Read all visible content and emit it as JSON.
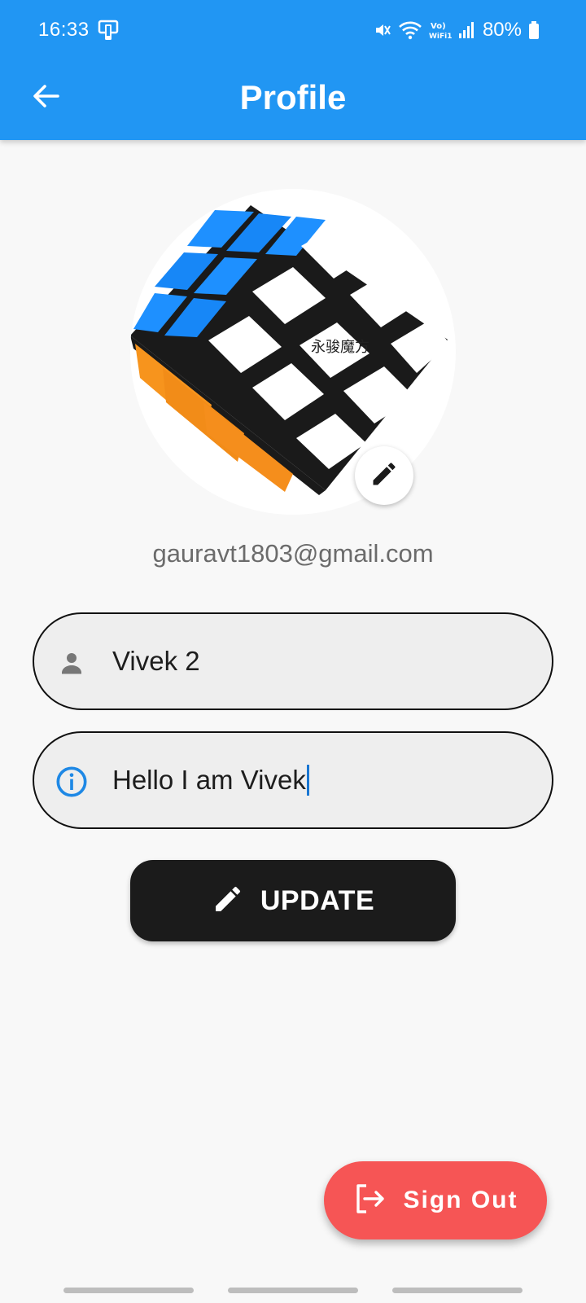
{
  "status_bar": {
    "time": "16:33",
    "battery": "80%",
    "network_label": "Vo) WiFi1",
    "icons": [
      "screen-cast-icon",
      "mute-icon",
      "wifi-icon",
      "vowifi-icon",
      "signal-icon",
      "battery-icon"
    ]
  },
  "app_bar": {
    "title": "Profile",
    "back_icon": "arrow-left-icon",
    "background": "#2196f3"
  },
  "profile": {
    "avatar_description": "rubiks-cube-image",
    "avatar_logo_text": "永骏魔方",
    "edit_icon": "pencil-icon",
    "email": "gauravt1803@gmail.com"
  },
  "form": {
    "name": {
      "value": "Vivek 2",
      "icon": "person-icon"
    },
    "bio": {
      "value": "Hello I am Vivek",
      "icon": "info-icon",
      "focused": true
    }
  },
  "update_button": {
    "label": "UPDATE",
    "icon": "pencil-icon",
    "color": "#1b1b1b"
  },
  "signout_button": {
    "label": "Sign Out",
    "icon": "logout-icon",
    "color": "#f65555"
  }
}
